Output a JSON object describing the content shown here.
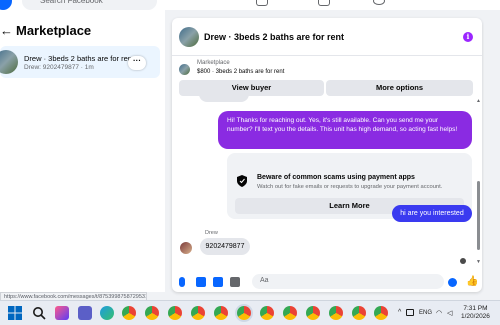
{
  "browser": {
    "search_placeholder": "Search Facebook",
    "status_url": "https://www.facebook.com/messages/t/8753998758729531/"
  },
  "left_panel": {
    "title": "Marketplace",
    "conversation": {
      "name": "Drew · 3beds 2 baths are for rent",
      "subtitle": "Drew: 9202479877 · 1m",
      "more_label": "···"
    }
  },
  "chat": {
    "header_title": "Drew · 3beds 2 baths are for rent",
    "marketplace_label": "Marketplace",
    "listing_line": "$800 · 3beds 2 baths are for rent",
    "view_buyer_label": "View buyer",
    "more_options_label": "More options",
    "messages": [
      {
        "from": "me",
        "text": "Hi! Thanks for reaching out. Yes, it's still available. Can you send me your number? I'll text you the details. This unit has high demand, so acting fast helps!"
      },
      {
        "from": "me",
        "text": "hi are you interested"
      },
      {
        "from": "Drew",
        "text": "9202479877"
      }
    ],
    "scam_card": {
      "title": "Beware of common scams using payment apps",
      "subtitle": "Watch out for fake emails or requests to upgrade your payment account.",
      "button_label": "Learn More"
    },
    "sender_name": "Drew",
    "composer_placeholder": "Aa"
  },
  "taskbar": {
    "language": "ENG",
    "time": "7:31 PM",
    "date": "1/20/2026"
  },
  "colors": {
    "accent_blue": "#0866ff",
    "bubble_purple": "#8a2be2",
    "bubble_blue": "#3a3af0",
    "info_purple": "#9b26ff"
  }
}
